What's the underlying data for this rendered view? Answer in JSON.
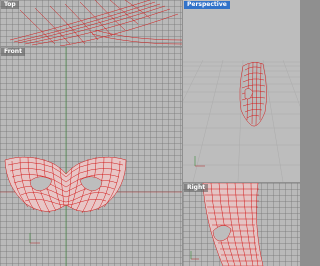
{
  "viewports": {
    "top": {
      "label": "Top"
    },
    "perspective": {
      "label": "Perspective"
    },
    "front": {
      "label": "Front"
    },
    "right": {
      "label": "Right"
    }
  },
  "colors": {
    "wireframe": "#d21a1a",
    "grid": "#9a9a9a",
    "active_title": "#3273c9",
    "x_axis": "#b23b3b",
    "y_axis": "#3a8a3a"
  }
}
